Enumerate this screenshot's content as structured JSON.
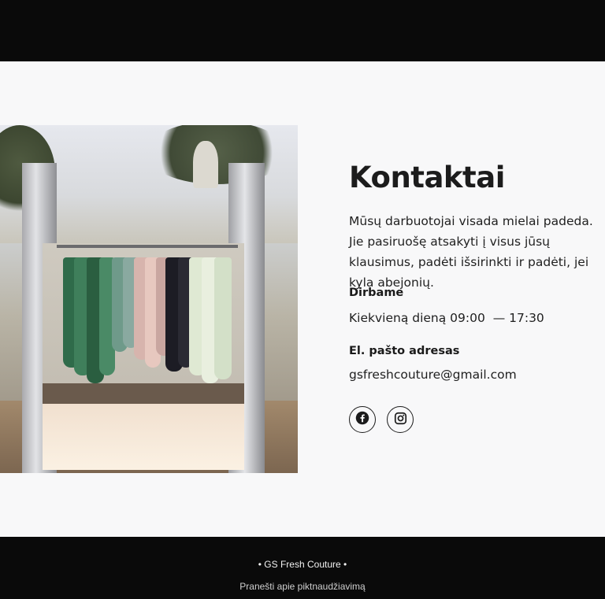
{
  "contact": {
    "title": "Kontaktai",
    "description": "Mūsų darbuotojai visada mielai padeda. Jie pasiruošę atsakyti į visus jūsų klausimus, padėti išsirinkti ir padėti, jei kyla abejonių.",
    "hours_label": "Dirbame",
    "hours_value": "Kiekvieną dieną 09:00  — 17:30",
    "email_label": "El. pašto adresas",
    "email_value": "gsfreshcouture@gmail.com"
  },
  "social": [
    {
      "icon": "facebook-icon"
    },
    {
      "icon": "instagram-icon"
    }
  ],
  "footer": {
    "brand": "• GS Fresh Couture •",
    "report_link": "Pranešti apie piktnaudžiavimą"
  },
  "colors": {
    "header_bg": "#0a0a0a",
    "page_bg": "#f8f8f9",
    "text": "#1c1c1c",
    "footer_bg": "#0a0a0a"
  }
}
